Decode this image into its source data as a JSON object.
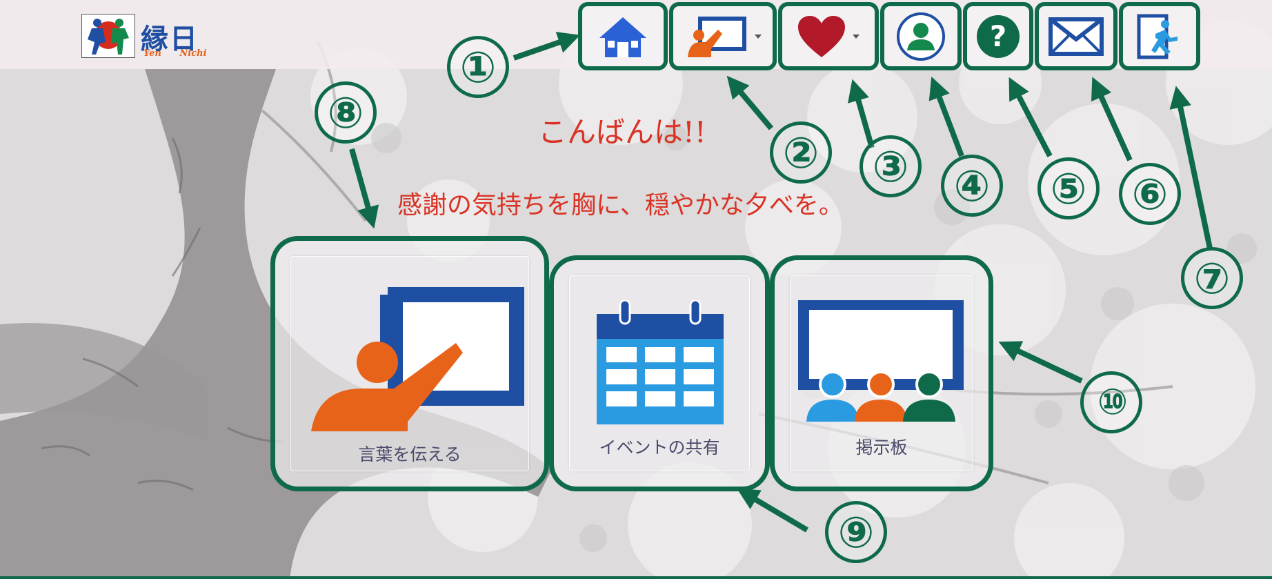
{
  "app": {
    "logo_text": "縁日",
    "logo_sub": "Yen Nichi"
  },
  "nav": {
    "items": [
      {
        "name": "home",
        "icon": "home-icon"
      },
      {
        "name": "lecture",
        "icon": "presenter-icon",
        "has_dropdown": true
      },
      {
        "name": "favorites",
        "icon": "heart-icon",
        "has_dropdown": true
      },
      {
        "name": "profile",
        "icon": "user-icon"
      },
      {
        "name": "help",
        "icon": "question-icon"
      },
      {
        "name": "mail",
        "icon": "envelope-icon"
      },
      {
        "name": "logout",
        "icon": "exit-icon"
      }
    ]
  },
  "greeting": "こんばんは!!",
  "message": "感謝の気持ちを胸に、穏やかな夕べを。",
  "cards": [
    {
      "label": "言葉を伝える",
      "icon": "presenter-icon"
    },
    {
      "label": "イベントの共有",
      "icon": "calendar-icon"
    },
    {
      "label": "掲示板",
      "icon": "board-icon"
    }
  ],
  "annotations": [
    "①",
    "②",
    "③",
    "④",
    "⑤",
    "⑥",
    "⑦",
    "⑧",
    "⑨",
    "⑩"
  ],
  "colors": {
    "annotation_green": "#0e6a48",
    "greeting_red": "#d93325",
    "icon_blue": "#1f4fa3",
    "icon_orange": "#e8631a",
    "heart_red": "#b21a2a"
  }
}
